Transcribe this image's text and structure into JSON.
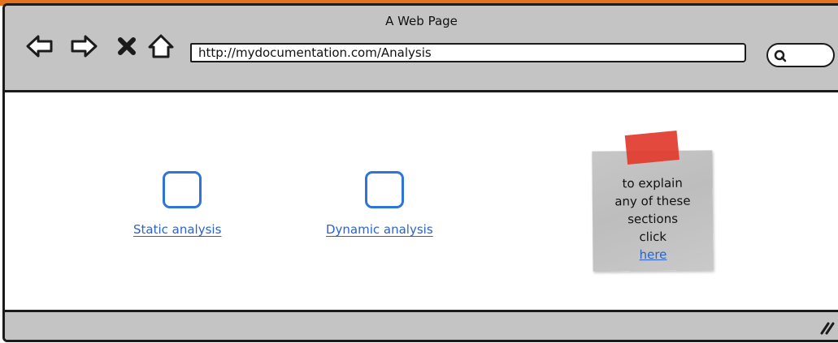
{
  "window": {
    "title": "A Web Page"
  },
  "toolbar": {
    "back_icon": "back-arrow-icon",
    "forward_icon": "forward-arrow-icon",
    "stop_icon": "close-x-icon",
    "home_icon": "home-icon",
    "url": "http://mydocumentation.com/Analysis",
    "search_icon": "search-icon"
  },
  "content": {
    "items": [
      {
        "label": "Static analysis"
      },
      {
        "label": "Dynamic analysis"
      }
    ],
    "note": {
      "lines": [
        "to explain",
        "any of these",
        "sections",
        "click"
      ],
      "link_text": "here"
    }
  },
  "colors": {
    "accent": "#2b63c7",
    "checkbox_border": "#2f74d8",
    "chrome": "#c4c4c4",
    "tape": "#e23b2e",
    "top_strip": "#e3711e"
  }
}
